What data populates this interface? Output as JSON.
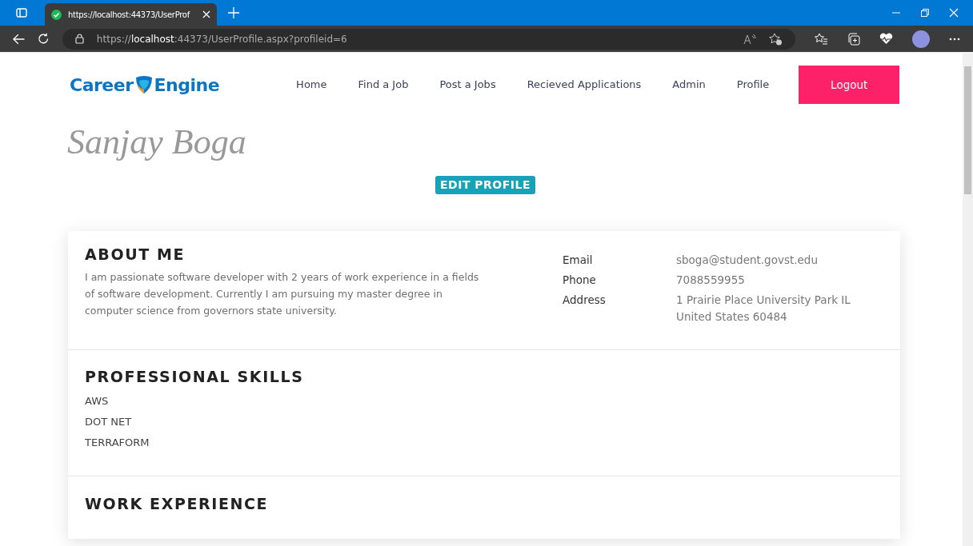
{
  "browser": {
    "tab_title": "https://localhost:44373/UserProf",
    "url_prefix": "https://",
    "url_host": "localhost",
    "url_rest": ":44373/UserProfile.aspx?profileid=6"
  },
  "navbar": {
    "logo_left": "Career",
    "logo_right": "Engine",
    "links": [
      {
        "label": "Home"
      },
      {
        "label": "Find a Job"
      },
      {
        "label": "Post a Jobs"
      },
      {
        "label": "Recieved Applications"
      },
      {
        "label": "Admin"
      },
      {
        "label": "Profile"
      }
    ],
    "logout": "Logout"
  },
  "profile": {
    "name": "Sanjay Boga",
    "edit_button": "EDIT PROFILE"
  },
  "about": {
    "heading": "ABOUT ME",
    "text": "I am passionate software developer with 2 years of work experience in a fields of software development. Currently I am pursuing my master degree in computer science from governors state university.",
    "contacts": [
      {
        "label": "Email",
        "value": "sboga@student.govst.edu"
      },
      {
        "label": "Phone",
        "value": "7088559955"
      },
      {
        "label": "Address",
        "value": "1 Prairie Place University Park IL United States 60484"
      }
    ]
  },
  "skills": {
    "heading": "PROFESSIONAL SKILLS",
    "items": [
      "AWS",
      "DOT NET",
      "TERRAFORM"
    ]
  },
  "experience": {
    "heading": "WORK EXPERIENCE"
  }
}
